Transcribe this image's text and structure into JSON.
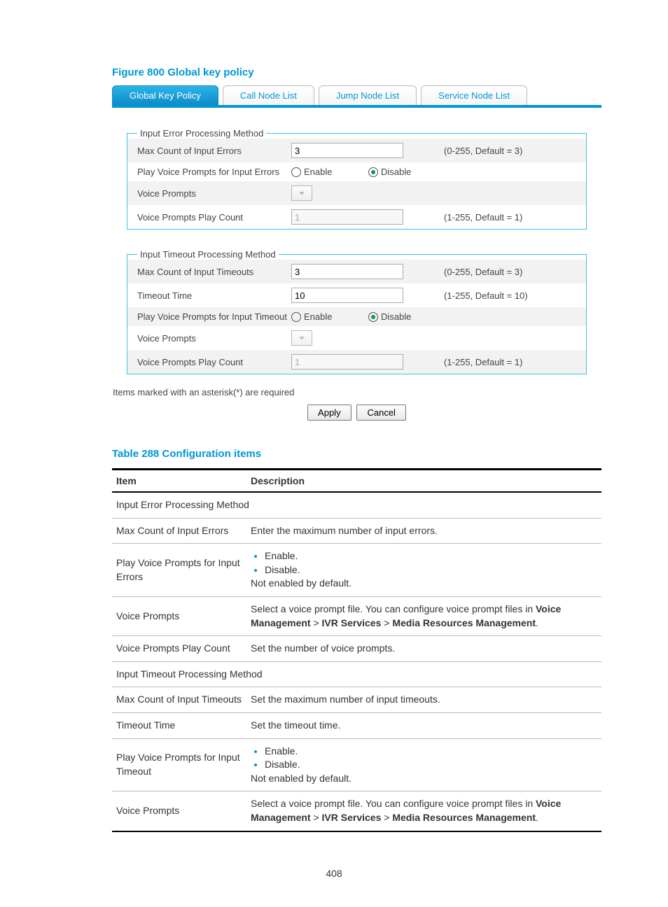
{
  "figure_title": "Figure 800 Global key policy",
  "tabs": {
    "global_key_policy": "Global Key Policy",
    "call_node_list": "Call Node List",
    "jump_node_list": "Jump Node List",
    "service_node_list": "Service Node List"
  },
  "fieldset1": {
    "legend": "Input Error Processing Method",
    "max_errors_label": "Max Count of Input Errors",
    "max_errors_value": "3",
    "max_errors_hint": "(0-255, Default = 3)",
    "play_prompts_label": "Play Voice Prompts for Input Errors",
    "enable_label": "Enable",
    "disable_label": "Disable",
    "voice_prompts_label": "Voice Prompts",
    "play_count_label": "Voice Prompts Play Count",
    "play_count_value": "1",
    "play_count_hint": "(1-255, Default = 1)"
  },
  "fieldset2": {
    "legend": "Input Timeout Processing Method",
    "max_timeouts_label": "Max Count of Input Timeouts",
    "max_timeouts_value": "3",
    "max_timeouts_hint": "(0-255, Default = 3)",
    "timeout_time_label": "Timeout Time",
    "timeout_time_value": "10",
    "timeout_time_hint": "(1-255, Default = 10)",
    "play_prompts_label": "Play Voice Prompts for Input Timeout",
    "enable_label": "Enable",
    "disable_label": "Disable",
    "voice_prompts_label": "Voice Prompts",
    "play_count_label": "Voice Prompts Play Count",
    "play_count_value": "1",
    "play_count_hint": "(1-255, Default = 1)"
  },
  "note": "Items marked with an asterisk(*) are required",
  "buttons": {
    "apply": "Apply",
    "cancel": "Cancel"
  },
  "table_title": "Table 288 Configuration items",
  "table_header": {
    "item": "Item",
    "description": "Description"
  },
  "table_rows": {
    "section1": "Input Error Processing Method",
    "r1_item": "Max Count of Input Errors",
    "r1_desc": "Enter the maximum number of input errors.",
    "r2_item": "Play Voice Prompts for Input Errors",
    "r2_b1": "Enable.",
    "r2_b2": "Disable.",
    "r2_tail": "Not enabled by default.",
    "r3_item": "Voice Prompts",
    "r3_pre": "Select a voice prompt file. You can configure voice prompt files in ",
    "r3_b1": "Voice Management",
    "r3_sep1": " > ",
    "r3_b2": "IVR Services",
    "r3_sep2": " > ",
    "r3_b3": "Media Resources Management",
    "r3_tail": ".",
    "r4_item": "Voice Prompts Play Count",
    "r4_desc": "Set the number of voice prompts.",
    "section2": "Input Timeout Processing Method",
    "r5_item": "Max Count of Input Timeouts",
    "r5_desc": "Set the maximum number of input timeouts.",
    "r6_item": "Timeout Time",
    "r6_desc": "Set the timeout time.",
    "r7_item": "Play Voice Prompts for Input Timeout",
    "r7_b1": "Enable.",
    "r7_b2": "Disable.",
    "r7_tail": "Not enabled by default.",
    "r8_item": "Voice Prompts",
    "r8_pre": "Select a voice prompt file. You can configure voice prompt files in ",
    "r8_b1": "Voice Management",
    "r8_sep1": " > ",
    "r8_b2": "IVR Services",
    "r8_sep2": " > ",
    "r8_b3": "Media Resources Management",
    "r8_tail": "."
  },
  "page_number": "408"
}
